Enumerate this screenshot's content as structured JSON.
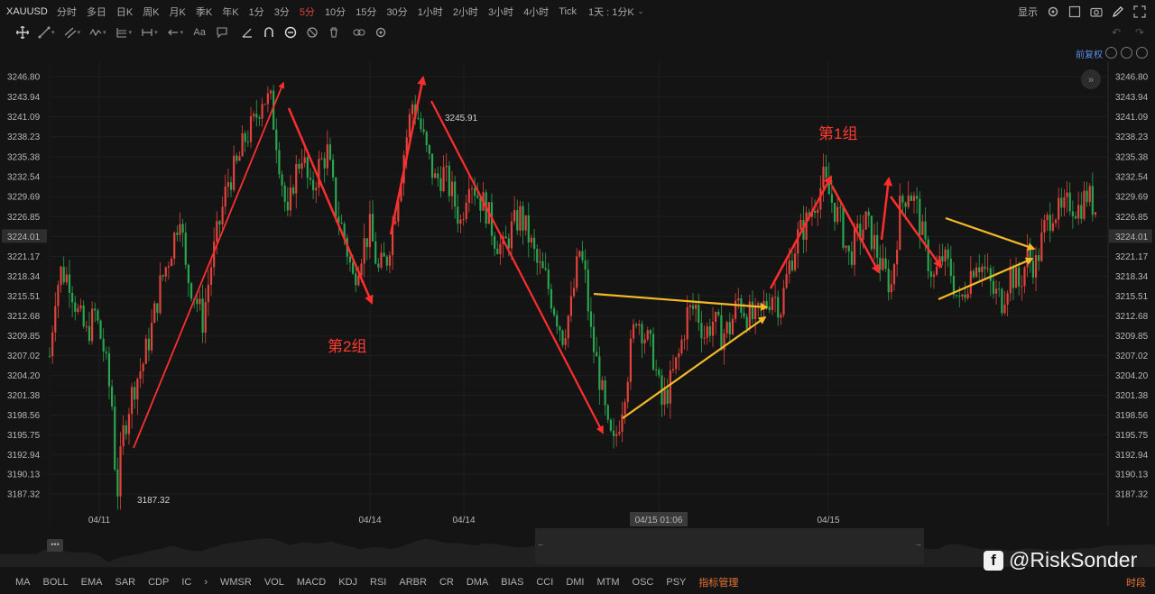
{
  "symbol": "XAUUSD",
  "periods": [
    "分时",
    "多日",
    "日K",
    "周K",
    "月K",
    "季K",
    "年K",
    "1分",
    "3分",
    "5分",
    "10分",
    "15分",
    "30分",
    "1小时",
    "2小时",
    "3小时",
    "4小时",
    "Tick"
  ],
  "active_period": "5分",
  "period_extra": "1天 : 1分K",
  "top_right": {
    "display_label": "显示"
  },
  "fq_label": "前复权",
  "chart_data": {
    "type": "candlestick",
    "price_ticks": [
      3246.8,
      3243.94,
      3241.09,
      3238.23,
      3235.38,
      3232.54,
      3229.69,
      3226.85,
      3224.01,
      3221.17,
      3218.34,
      3215.51,
      3212.68,
      3209.85,
      3207.02,
      3204.2,
      3201.38,
      3198.56,
      3195.75,
      3192.94,
      3190.13,
      3187.32
    ],
    "ylim": [
      3186.0,
      3248.0
    ],
    "current_price": 3224.01,
    "x_ticks": [
      "04/11",
      "04/14",
      "04/14",
      "04/15 01:06",
      "04/15"
    ],
    "crosshair_time": "04/15 01:06",
    "high_label": "3245.91",
    "low_label": "3187.32",
    "annotations": [
      "第2组",
      "第1组"
    ],
    "colors": {
      "up": "#e0433b",
      "down": "#2aa44f",
      "red_arrow": "#ff2e2e",
      "yellow_arrow": "#f5b928",
      "text_red": "#ff3b30"
    },
    "price_path": [
      [
        0,
        3207
      ],
      [
        2,
        3216
      ],
      [
        4,
        3219
      ],
      [
        7,
        3218
      ],
      [
        10,
        3213
      ],
      [
        13,
        3210
      ],
      [
        16,
        3213
      ],
      [
        19,
        3208
      ],
      [
        22,
        3200
      ],
      [
        23,
        3192
      ],
      [
        24,
        3188
      ],
      [
        26,
        3196
      ],
      [
        28,
        3200
      ],
      [
        30,
        3203
      ],
      [
        33,
        3206
      ],
      [
        36,
        3211
      ],
      [
        39,
        3217
      ],
      [
        42,
        3221
      ],
      [
        44,
        3224
      ],
      [
        46,
        3228
      ],
      [
        48,
        3219
      ],
      [
        51,
        3216
      ],
      [
        54,
        3212
      ],
      [
        57,
        3220
      ],
      [
        60,
        3226
      ],
      [
        63,
        3232
      ],
      [
        66,
        3234
      ],
      [
        69,
        3238
      ],
      [
        72,
        3240
      ],
      [
        75,
        3244
      ],
      [
        78,
        3243
      ],
      [
        80,
        3238
      ],
      [
        82,
        3232
      ],
      [
        84,
        3226
      ],
      [
        86,
        3232
      ],
      [
        89,
        3236
      ],
      [
        92,
        3230
      ],
      [
        95,
        3234
      ],
      [
        98,
        3236
      ],
      [
        101,
        3228
      ],
      [
        104,
        3224
      ],
      [
        107,
        3218
      ],
      [
        110,
        3222
      ],
      [
        113,
        3225
      ],
      [
        116,
        3219
      ],
      [
        119,
        3221
      ],
      [
        122,
        3228
      ],
      [
        125,
        3236
      ],
      [
        128,
        3243
      ],
      [
        130,
        3241
      ],
      [
        133,
        3236
      ],
      [
        136,
        3232
      ],
      [
        139,
        3233
      ],
      [
        142,
        3230
      ],
      [
        145,
        3226
      ],
      [
        148,
        3233
      ],
      [
        151,
        3230
      ],
      [
        154,
        3228
      ],
      [
        157,
        3224
      ],
      [
        160,
        3222
      ],
      [
        163,
        3225
      ],
      [
        166,
        3227
      ],
      [
        169,
        3224
      ],
      [
        172,
        3220
      ],
      [
        175,
        3218
      ],
      [
        178,
        3214
      ],
      [
        181,
        3210
      ],
      [
        184,
        3214
      ],
      [
        187,
        3222
      ],
      [
        189,
        3218
      ],
      [
        191,
        3210
      ],
      [
        194,
        3204
      ],
      [
        197,
        3196
      ],
      [
        199,
        3194
      ],
      [
        201,
        3198
      ],
      [
        204,
        3205
      ],
      [
        207,
        3213
      ],
      [
        210,
        3210
      ],
      [
        213,
        3207
      ],
      [
        216,
        3200
      ],
      [
        219,
        3203
      ],
      [
        222,
        3207
      ],
      [
        225,
        3213
      ],
      [
        228,
        3214
      ],
      [
        231,
        3210
      ],
      [
        234,
        3212
      ],
      [
        237,
        3210
      ],
      [
        240,
        3211
      ],
      [
        243,
        3215
      ],
      [
        246,
        3213
      ],
      [
        249,
        3212
      ],
      [
        252,
        3214
      ],
      [
        255,
        3216
      ],
      [
        258,
        3214
      ],
      [
        261,
        3220
      ],
      [
        264,
        3224
      ],
      [
        267,
        3226
      ],
      [
        270,
        3229
      ],
      [
        273,
        3232
      ],
      [
        276,
        3229
      ],
      [
        279,
        3226
      ],
      [
        282,
        3221
      ],
      [
        285,
        3224
      ],
      [
        288,
        3226
      ],
      [
        291,
        3223
      ],
      [
        294,
        3219
      ],
      [
        297,
        3217
      ],
      [
        300,
        3228
      ],
      [
        303,
        3231
      ],
      [
        306,
        3228
      ],
      [
        309,
        3222
      ],
      [
        312,
        3218
      ],
      [
        315,
        3221
      ],
      [
        318,
        3219
      ],
      [
        321,
        3214
      ],
      [
        324,
        3218
      ],
      [
        327,
        3221
      ],
      [
        330,
        3219
      ],
      [
        333,
        3216
      ],
      [
        336,
        3215
      ],
      [
        339,
        3219
      ],
      [
        342,
        3217
      ],
      [
        345,
        3221
      ],
      [
        348,
        3220
      ],
      [
        351,
        3225
      ],
      [
        354,
        3228
      ],
      [
        357,
        3227
      ],
      [
        360,
        3229
      ],
      [
        363,
        3228
      ],
      [
        366,
        3230
      ],
      [
        369,
        3228
      ]
    ]
  },
  "indicators": [
    "MA",
    "BOLL",
    "EMA",
    "SAR",
    "CDP",
    "IC",
    "WMSR",
    "VOL",
    "MACD",
    "KDJ",
    "RSI",
    "ARBR",
    "CR",
    "DMA",
    "BIAS",
    "CCI",
    "DMI",
    "MTM",
    "OSC",
    "PSY"
  ],
  "indicator_manager": "指标管理",
  "time_segment": "时段",
  "watermark": "@RiskSonder"
}
